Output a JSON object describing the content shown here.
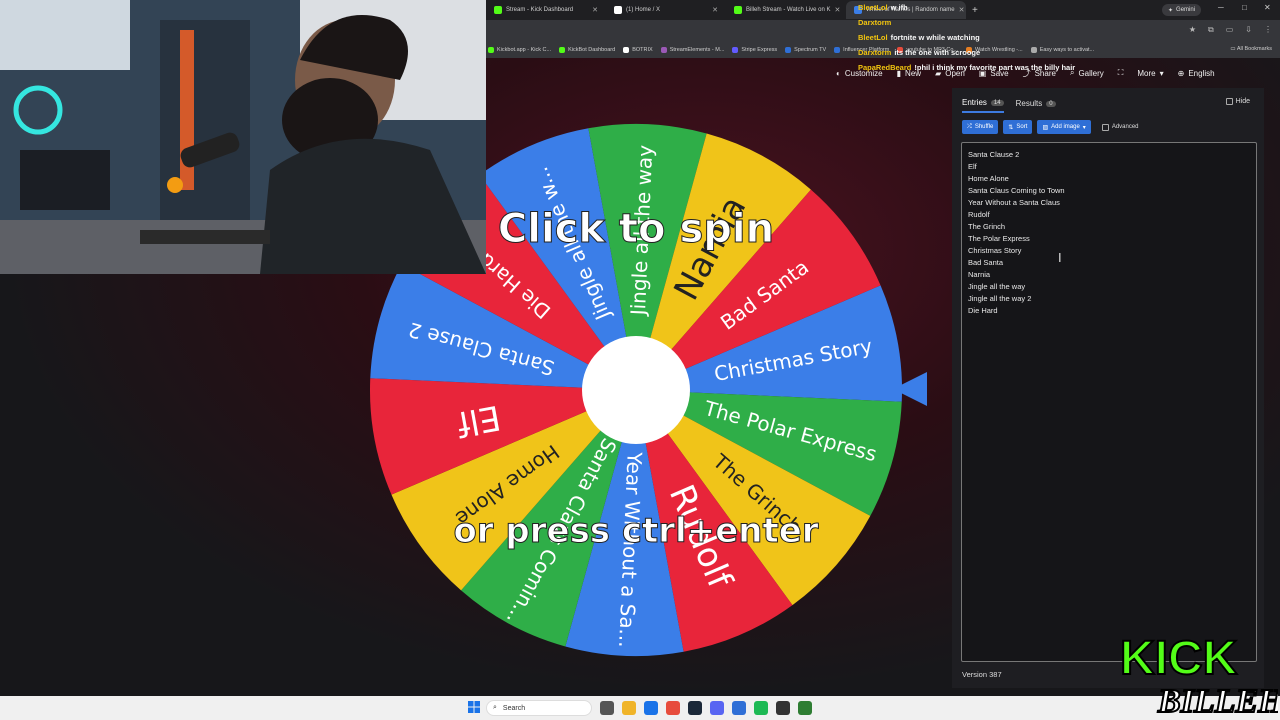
{
  "browser": {
    "tabs": [
      {
        "label": "Stream - Kick Dashboard",
        "color": "#53fc18"
      },
      {
        "label": "(1) Home / X",
        "color": "#ffffff"
      },
      {
        "label": "Billeh Stream - Watch Live on K",
        "color": "#53fc18"
      },
      {
        "label": "Wheel of Names | Random name",
        "color": "#3b7ee8",
        "active": true
      }
    ],
    "new_tab": "+",
    "gemini_label": "Gemini",
    "bookmarks": [
      {
        "label": "Kickbot.app - Kick C...",
        "color": "#53fc18"
      },
      {
        "label": "KickBot Dashboard",
        "color": "#53fc18"
      },
      {
        "label": "BOTRIX",
        "color": "#ffffff"
      },
      {
        "label": "StreamElements - M...",
        "color": "#9b59b6"
      },
      {
        "label": "Stripe Express",
        "color": "#635bff"
      },
      {
        "label": "Spectrum TV",
        "color": "#2f6fd6"
      },
      {
        "label": "Influencer Platform",
        "color": "#2f6fd6"
      },
      {
        "label": "youtube to MP3 Co...",
        "color": "#e74c3c"
      },
      {
        "label": "Watch Wrestling -...",
        "color": "#e67e22"
      },
      {
        "label": "Easy ways to activat...",
        "color": "#aaaaaa"
      }
    ],
    "all_bookmarks": "All Bookmarks"
  },
  "app": {
    "toolbar": {
      "customize": "Customize",
      "new": "New",
      "open": "Open",
      "save": "Save",
      "share": "Share",
      "gallery": "Gallery",
      "more": "More",
      "language": "English"
    },
    "panel": {
      "tab_entries": "Entries",
      "entries_count": "14",
      "tab_results": "Results",
      "results_count": "0",
      "hide": "Hide",
      "shuffle": "Shuffle",
      "sort": "Sort",
      "add_image": "Add image",
      "advanced": "Advanced",
      "entries": [
        "Santa Clause 2",
        "Elf",
        "Home Alone",
        "Santa Claus Coming to Town",
        "Year Without a Santa Claus",
        "Rudolf",
        "The Grinch",
        "The Polar Express",
        "Christmas Story",
        "Bad Santa",
        "Narnia",
        "Jingle all the way",
        "Jingle all the way 2",
        "Die Hard"
      ],
      "version": "Version 387"
    },
    "wheel": {
      "colors": [
        "#3b7ee8",
        "#e8253a",
        "#2fae48",
        "#f0c419"
      ],
      "slices": [
        {
          "label": "Christmas Story",
          "color": "#3b7ee8"
        },
        {
          "label": "The Polar Express",
          "color": "#2fae48"
        },
        {
          "label": "The Grinch",
          "color": "#f0c419"
        },
        {
          "label": "Rudolf",
          "color": "#e8253a"
        },
        {
          "label": "Year Without a Sa...",
          "color": "#3b7ee8"
        },
        {
          "label": "Santa Claus Comin...",
          "color": "#2fae48"
        },
        {
          "label": "Home Alone",
          "color": "#f0c419"
        },
        {
          "label": "Elf",
          "color": "#e8253a"
        },
        {
          "label": "Santa Clause 2",
          "color": "#3b7ee8"
        },
        {
          "label": "Die Hard",
          "color": "#e8253a"
        },
        {
          "label": "Jingle all the w...",
          "color": "#3b7ee8"
        },
        {
          "label": "Jingle all the way",
          "color": "#2fae48"
        },
        {
          "label": "Narnia",
          "color": "#f0c419"
        },
        {
          "label": "Bad Santa",
          "color": "#e8253a"
        }
      ],
      "center_top": "Click to spin",
      "center_bottom": "or press ctrl+enter"
    }
  },
  "chat": [
    {
      "user": "BleetLol",
      "msg": "w ifh"
    },
    {
      "user": "Darxtorm",
      "msg": ""
    },
    {
      "user": "BleetLol",
      "msg": "fortnite w while watching"
    },
    {
      "user": "Darxtorm",
      "msg": "its the one with scrooge"
    },
    {
      "user": "PapaRedBeard",
      "msg": "!phil i think my favorite part was the billy hair"
    }
  ],
  "taskbar": {
    "search_placeholder": "Search",
    "icons": [
      "#555555",
      "#f0b429",
      "#1a73e8",
      "#e74c3c",
      "#1b2838",
      "#5865f2",
      "#2f6fd6",
      "#1db954",
      "#333333",
      "#2e7d32"
    ]
  },
  "overlay_logo": {
    "text1": "KICK",
    "text2": "BILLEH"
  }
}
